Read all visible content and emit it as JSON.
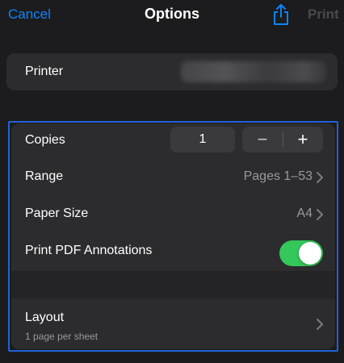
{
  "nav": {
    "cancel_label": "Cancel",
    "title": "Options",
    "share_icon": "share-icon",
    "print_label": "Print"
  },
  "printer": {
    "label": "Printer",
    "value": "No Printer Selected"
  },
  "options": {
    "copies": {
      "label": "Copies",
      "value": "1",
      "minus": "−",
      "plus": "+"
    },
    "range": {
      "label": "Range",
      "value": "Pages 1–53"
    },
    "paper_size": {
      "label": "Paper Size",
      "value": "A4"
    },
    "annotations": {
      "label": "Print PDF Annotations",
      "enabled": true
    },
    "layout": {
      "label": "Layout",
      "subtitle": "1 page per sheet"
    }
  },
  "colors": {
    "accent": "#0a84ff",
    "toggle_on": "#34c759",
    "selection_border": "#1f63d6",
    "disabled_text": "#4a4a4c"
  }
}
